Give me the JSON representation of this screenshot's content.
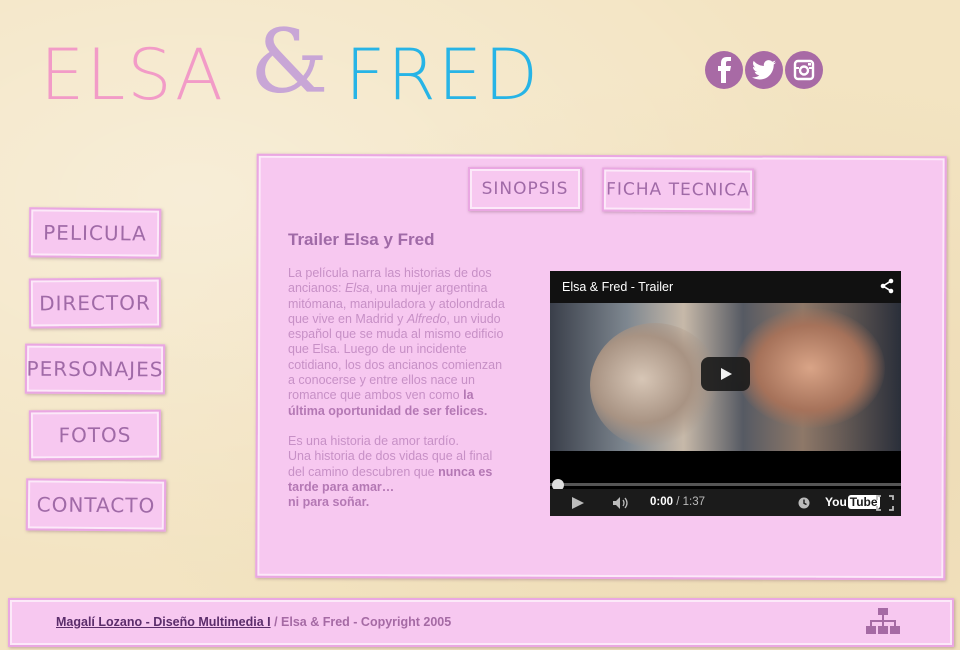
{
  "logo": {
    "part1": "ELSA",
    "part2": "&",
    "part3": "FRED",
    "colors": {
      "elsa": "#f29bc7",
      "amp": "#c8a6d6",
      "fred": "#27b4e6"
    }
  },
  "social": [
    {
      "name": "facebook",
      "glyph": "f"
    },
    {
      "name": "twitter",
      "glyph": "t"
    },
    {
      "name": "instagram",
      "glyph": "ig"
    }
  ],
  "nav": {
    "items": [
      "PELICULA",
      "DIRECTOR",
      "PERSONAJES",
      "FOTOS",
      "CONTACTO"
    ]
  },
  "tabs": [
    "SINOPSIS",
    "FICHA TECNICA"
  ],
  "main": {
    "title": "Trailer Elsa y Fred",
    "p1_a": "La película narra las historias de dos ancianos: ",
    "p1_elsa": "Elsa",
    "p1_b": ", una mujer argentina mitómana, manipuladora y atolondrada que vive en Madrid y ",
    "p1_alfredo": "Alfredo",
    "p1_c": ", un viudo español que se muda al mismo edificio que Elsa. Luego de un incidente cotidiano, los dos ancianos comienzan a conocerse y entre ellos nace un romance que ambos ven como ",
    "p1_bold": "la última oportunidad de ser felices.",
    "p2_a": "Es una historia de amor tardío.",
    "p2_b": "Una historia de dos vidas que al final del camino descubren que ",
    "p2_bold1": "nunca es tarde para amar…",
    "p2_bold2": "ni para soñar."
  },
  "video": {
    "title": "Elsa & Fred - Trailer",
    "current": "0:00",
    "duration": "1:37",
    "logo_you": "You",
    "logo_tube": "Tube"
  },
  "footer": {
    "link": "Magalí Lozano - Diseño Multimedia I",
    "rest": " / Elsa & Fred - Copyright 2005"
  },
  "colors": {
    "accent": "#a06aa7",
    "paper": "#f7c8f0",
    "background": "#f3e4c2"
  }
}
